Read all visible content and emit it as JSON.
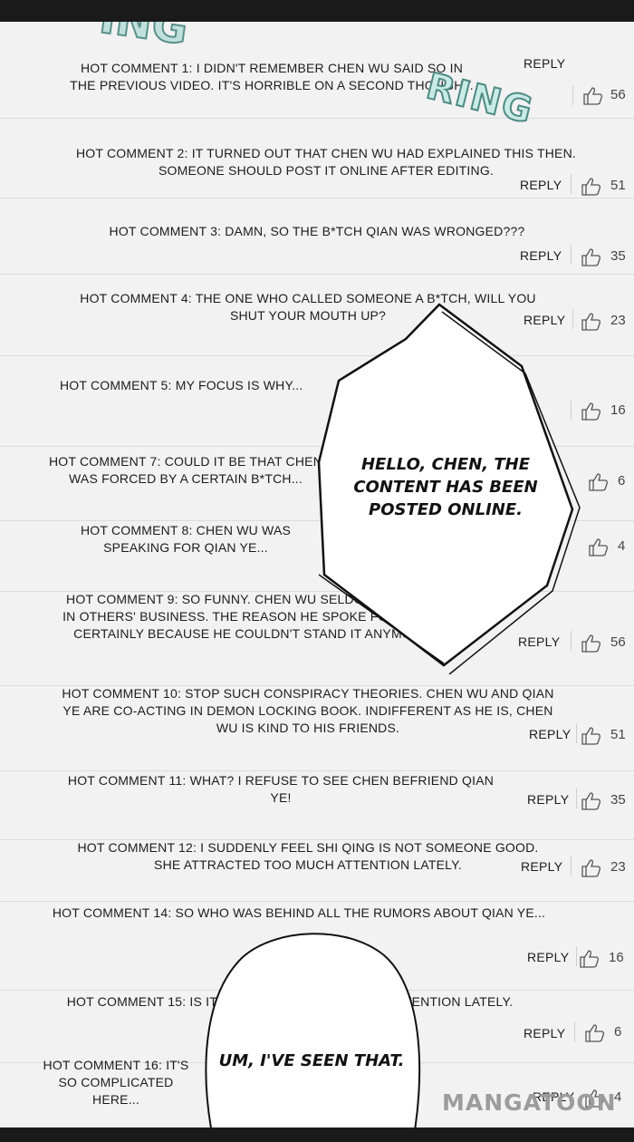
{
  "sfx": {
    "top": "ING",
    "ring": "RING"
  },
  "reply_label": "REPLY",
  "comments": [
    {
      "line1": "HOT COMMENT 1: I DIDN'T REMEMBER CHEN WU SAID SO IN",
      "line2": "THE PREVIOUS VIDEO. IT'S HORRIBLE ON A SECOND THOUGHT.",
      "likes": "56"
    },
    {
      "line1": "HOT COMMENT 2: IT TURNED OUT THAT CHEN WU HAD EXPLAINED THIS THEN.",
      "line2": "SOMEONE SHOULD POST IT ONLINE AFTER EDITING.",
      "likes": "51"
    },
    {
      "line1": "HOT COMMENT 3: DAMN, SO THE B*TCH QIAN WAS WRONGED???",
      "line2": "",
      "likes": "35"
    },
    {
      "line1": "HOT COMMENT 4: THE ONE WHO CALLED SOMEONE A B*TCH, WILL YOU",
      "line2": "SHUT YOUR MOUTH UP?",
      "likes": "23"
    },
    {
      "line1": "HOT COMMENT 5: MY FOCUS IS WHY...",
      "line2": "",
      "likes": "16"
    },
    {
      "line1": "HOT COMMENT 7: COULD IT BE THAT CHEN",
      "line2": "WAS FORCED BY A CERTAIN B*TCH...",
      "likes": "6"
    },
    {
      "line1": "HOT COMMENT 8: CHEN WU WAS",
      "line2": "SPEAKING FOR QIAN YE...",
      "likes": "4"
    },
    {
      "line1": "HOT COMMENT 9: SO FUNNY. CHEN WU SELDOM MEDDLES",
      "line2": "IN OTHERS' BUSINESS. THE REASON HE SPOKE FOR HER IS",
      "line3": "CERTAINLY BECAUSE HE COULDN'T STAND IT ANYMORE.",
      "likes": "56"
    },
    {
      "line1": "HOT COMMENT 10: STOP SUCH CONSPIRACY THEORIES. CHEN WU AND QIAN",
      "line2": "YE ARE CO-ACTING IN DEMON LOCKING BOOK. INDIFFERENT AS HE IS, CHEN",
      "line3": "WU IS KIND TO HIS FRIENDS.",
      "likes": "51"
    },
    {
      "line1": "HOT COMMENT 11: WHAT? I REFUSE TO SEE CHEN BEFRIEND QIAN",
      "line2": "YE!",
      "likes": "35"
    },
    {
      "line1": "HOT COMMENT 12: I SUDDENLY FEEL SHI QING IS NOT SOMEONE GOOD.",
      "line2": "SHE ATTRACTED TOO MUCH ATTENTION LATELY.",
      "likes": "23"
    },
    {
      "line1": "HOT COMMENT 14: SO WHO WAS BEHIND ALL THE RUMORS ABOUT QIAN YE...",
      "line2": "",
      "likes": "16"
    },
    {
      "line1": "HOT COMMENT 15: IS IT POSSIBLE THAT... HAD NO ATTENTION LATELY.",
      "line2": "",
      "likes": "6"
    },
    {
      "line1": "HOT COMMENT 16: IT'S",
      "line2": "SO COMPLICATED",
      "line3": "HERE...",
      "likes": "4"
    }
  ],
  "bubbles": {
    "phone": {
      "line1": "HELLO, CHEN, THE",
      "line2": "CONTENT HAS BEEN",
      "line3": "POSTED ONLINE."
    },
    "thought": {
      "line1": "UM, I'VE SEEN THAT."
    }
  },
  "watermark": "MANGATOON"
}
